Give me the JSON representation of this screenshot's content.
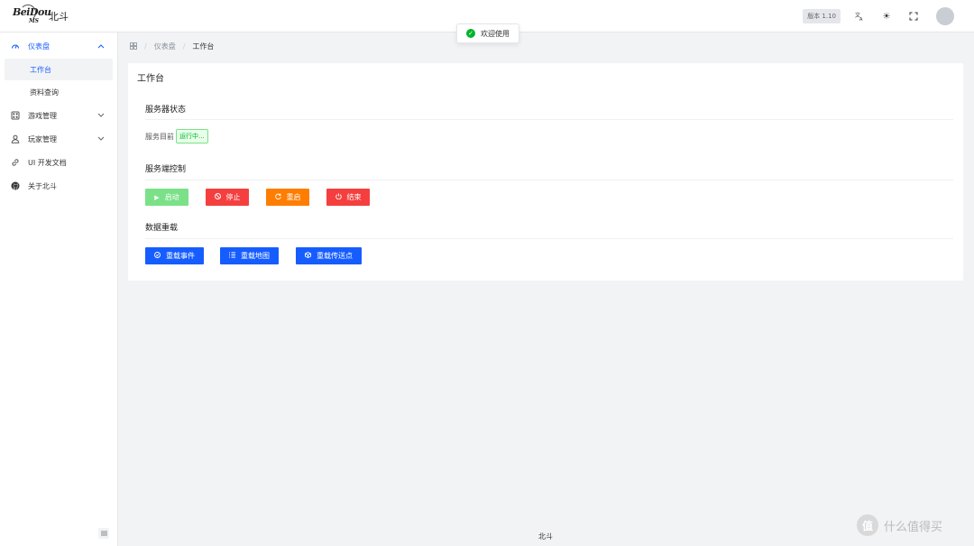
{
  "app": {
    "logo_text": "BeiDou",
    "logo_sub": "MS",
    "title": "北斗",
    "version": "版本 1.10"
  },
  "header_icons": [
    "translate-icon",
    "theme-icon",
    "fullscreen-icon"
  ],
  "toast": {
    "text": "欢迎使用",
    "icon": "success-check-icon",
    "color": "#00b42a"
  },
  "sidebar": {
    "items": [
      {
        "label": "仪表盘",
        "icon": "dashboard-icon",
        "expanded": true,
        "children": [
          {
            "label": "工作台",
            "active": true
          },
          {
            "label": "资料查询",
            "active": false
          }
        ]
      },
      {
        "label": "游戏管理",
        "icon": "game-icon",
        "expanded": false
      },
      {
        "label": "玩家管理",
        "icon": "user-icon",
        "expanded": false
      },
      {
        "label": "UI 开发文档",
        "icon": "link-icon"
      },
      {
        "label": "关于北斗",
        "icon": "github-icon"
      }
    ]
  },
  "breadcrumb": {
    "home_icon": "grid-icon",
    "items": [
      "仪表盘",
      "工作台"
    ]
  },
  "card": {
    "title": "工作台",
    "server_status": {
      "title": "服务器状态",
      "label": "服务目前",
      "status": "运行中..."
    },
    "server_control": {
      "title": "服务端控制",
      "buttons": [
        {
          "label": "启动",
          "icon": "play-icon",
          "color": "#7be188"
        },
        {
          "label": "停止",
          "icon": "stop-icon",
          "color": "#f53f3f"
        },
        {
          "label": "重启",
          "icon": "restart-icon",
          "color": "#ff7d00"
        },
        {
          "label": "结束",
          "icon": "power-icon",
          "color": "#f53f3f"
        }
      ]
    },
    "data_reload": {
      "title": "数据重载",
      "buttons": [
        {
          "label": "重载事件",
          "icon": "event-icon",
          "color": "#165dff"
        },
        {
          "label": "重载地图",
          "icon": "map-list-icon",
          "color": "#165dff"
        },
        {
          "label": "重载传送点",
          "icon": "portal-icon",
          "color": "#165dff"
        }
      ]
    }
  },
  "footer": {
    "text": "北斗"
  },
  "watermark": {
    "logo": "值",
    "text": "什么值得买"
  },
  "colors": {
    "primary": "#165dff",
    "success": "#00b42a",
    "danger": "#f53f3f",
    "warning": "#ff7d00"
  }
}
